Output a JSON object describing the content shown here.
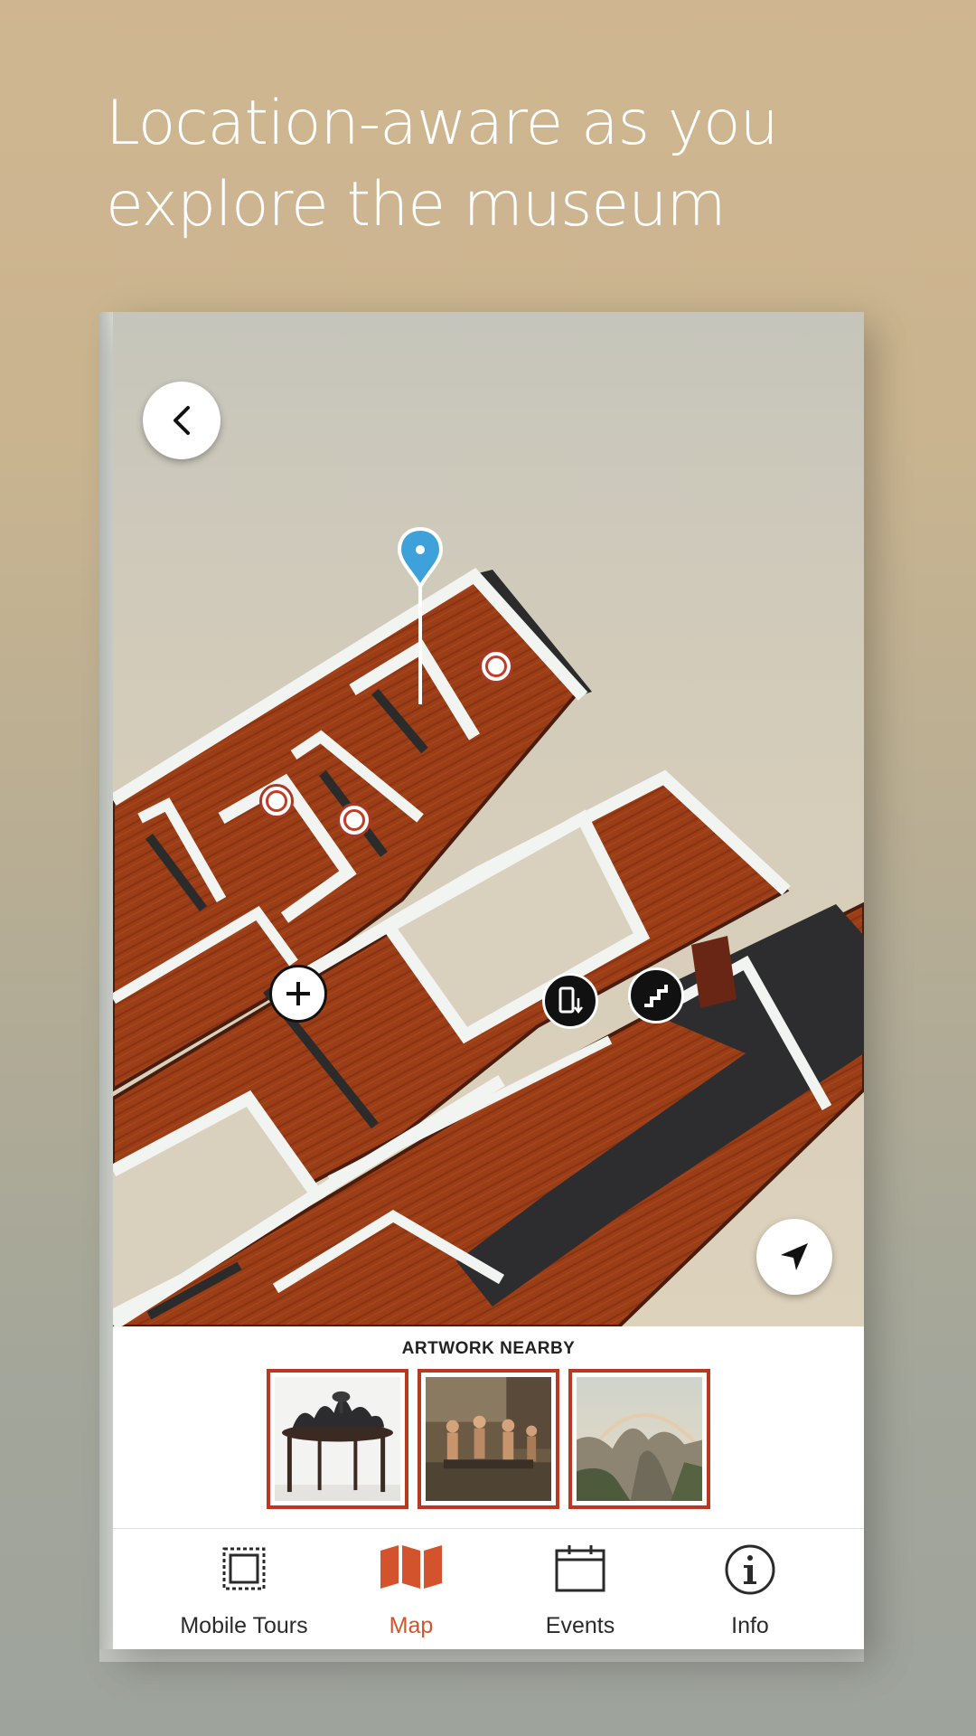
{
  "headline": {
    "line1": "Location-aware as you",
    "line2": "explore the museum"
  },
  "map": {
    "back_icon": "chevron-left-icon",
    "locate_icon": "navigation-arrow-icon",
    "pin_icon": "location-pin-icon",
    "plus_icon": "plus-icon",
    "elevator_icon": "elevator-icon",
    "stairs_icon": "stairs-icon",
    "colors": {
      "floor": "#9b3d16",
      "wall": "#f2f4f1",
      "pin": "#3ea1d9",
      "marker": "#c23c26"
    }
  },
  "nearby": {
    "title": "ARTWORK NEARBY",
    "thumbnails": [
      "table-sculpture",
      "figures-painting",
      "landscape-rainbow-painting"
    ]
  },
  "tabbar": {
    "active_color": "#d2532c",
    "tabs": [
      {
        "label": "Mobile Tours",
        "icon": "stamp-icon"
      },
      {
        "label": "Map",
        "icon": "map-icon"
      },
      {
        "label": "Events",
        "icon": "calendar-icon"
      },
      {
        "label": "Info",
        "icon": "info-icon"
      }
    ]
  }
}
